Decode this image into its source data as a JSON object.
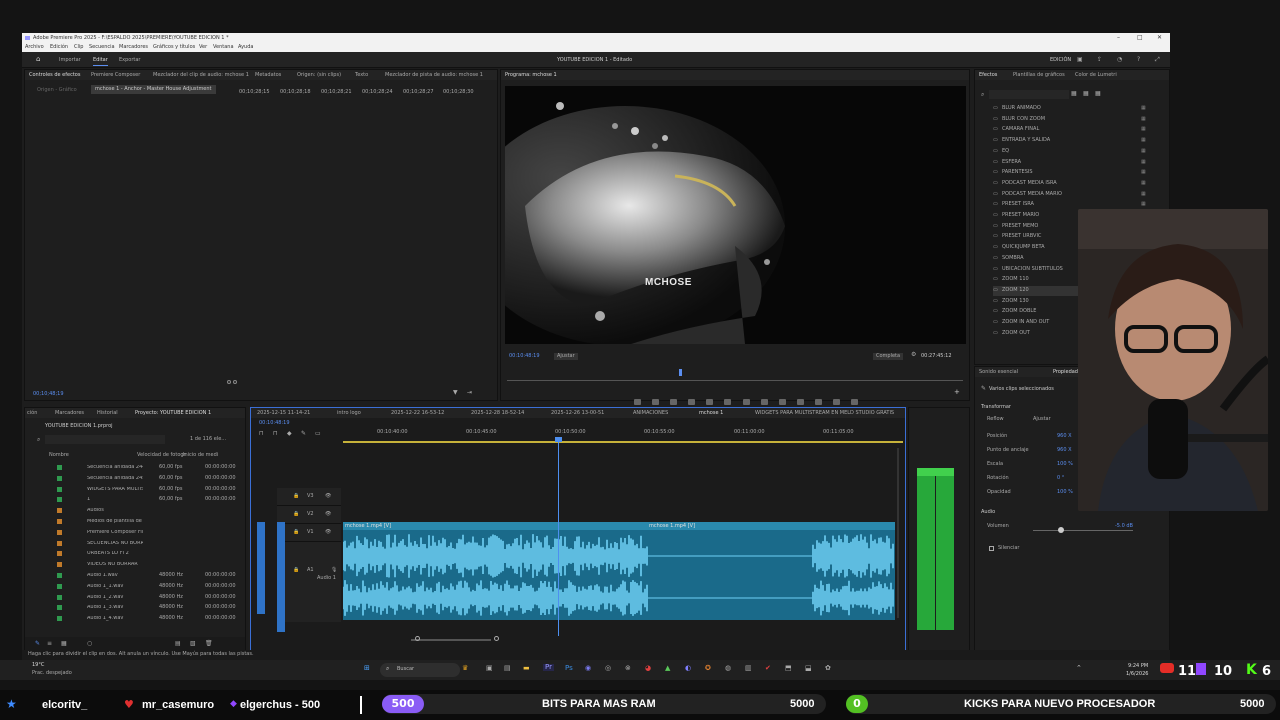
{
  "window": {
    "title": "Adobe Premiere Pro 2025 - F:\\ESPALDO 2025\\PREMIERE\\YOUTUBE EDICION 1 *"
  },
  "menu": [
    "Archivo",
    "Edición",
    "Clip",
    "Secuencia",
    "Marcadores",
    "Gráficos y títulos",
    "Ver",
    "Ventana",
    "Ayuda"
  ],
  "workspace": {
    "tabs": [
      "Importar",
      "Editar",
      "Exportar"
    ],
    "center_title": "YOUTUBE EDICION 1 - Editado",
    "right_label": "EDICIÓN"
  },
  "source_panel": {
    "tabs": [
      "Controles de efectos",
      "Premiere Composer",
      "Mezclador del clip de audio: mchose 1",
      "Metadatos",
      "Origen: (sin clips)",
      "Texto",
      "Mezclador de pista de audio: mchose 1"
    ],
    "sub_left": "Origen - Gráfico",
    "sub_selected": "mchose 1 - Anchor - Master House Adjustment",
    "ruler": [
      "00;10;28;15",
      "00;10;28;18",
      "00;10;28;21",
      "00;10;28;24",
      "00;10;28;27",
      "00;10;28;30"
    ],
    "timecode": "00;10;48;19"
  },
  "program": {
    "title": "Programa: mchose 1",
    "brand": "MCHOSE",
    "timecode_left": "00:10:48:19",
    "fit": "Ajustar",
    "quality": "Completa",
    "timecode_right": "00:27:45:12"
  },
  "effects": {
    "tabs": [
      "Efectos",
      "Plantillas de gráficos",
      "Color de Lumetri"
    ],
    "items": [
      "BLUR ANIMADO",
      "BLUR CON ZOOM",
      "CAMARA FINAL",
      "ENTRADA Y SALIDA",
      "EQ",
      "ESFERA",
      "PARENTESIS",
      "PODCAST MEDIA ISRA",
      "PODCAST MEDIA MARIO",
      "PRESET ISRA",
      "PRESET MARIO",
      "PRESET MEMO",
      "PRESET URBVIC",
      "QUICKJUMP BETA",
      "SOMBRA",
      "UBICACION SUBTITULOS",
      "ZOOM 110",
      "ZOOM 120",
      "ZOOM 130",
      "ZOOM DOBLE",
      "ZOOM IN AND OUT",
      "ZOOM OUT"
    ]
  },
  "properties": {
    "tabs": [
      "Sonido esencial",
      "Propiedades"
    ],
    "header": "Varios clips seleccionados",
    "transform": "Transformar",
    "reencuadre": "Reflow",
    "ajustar": "Ajustar",
    "rows": [
      {
        "label": "Posición",
        "value": "960 X"
      },
      {
        "label": "Punto de anclaje",
        "value": "960 X"
      },
      {
        "label": "Escala",
        "value": "100 %"
      },
      {
        "label": "Rotación",
        "value": "0 °"
      },
      {
        "label": "Opacidad",
        "value": "100 %"
      }
    ],
    "audio": "Audio",
    "volume_label": "Volumen",
    "volume_value": "-5.0 dB",
    "silence": "Silenciar"
  },
  "project": {
    "tabs": [
      "ción",
      "Marcadores",
      "Historial",
      "Proyecto: YOUTUBE EDICION 1"
    ],
    "file": "YOUTUBE EDICION 1.prproj",
    "count": "1 de 116 ele...",
    "columns": [
      "Nombre",
      "Velocidad de fotogr",
      "Inicio de medi"
    ],
    "items": [
      {
        "name": "Secuencia anidada 244",
        "fps": "60,00 fps",
        "start": "00:00:00:00",
        "color": "#2f9a4f"
      },
      {
        "name": "Secuencia anidada 245",
        "fps": "60,00 fps",
        "start": "00:00:00:00",
        "color": "#2f9a4f"
      },
      {
        "name": "WIDGETS PARA MULTISTRE",
        "fps": "60,00 fps",
        "start": "00:00:00:00",
        "color": "#2f9a4f"
      },
      {
        "name": "1",
        "fps": "60,00 fps",
        "start": "00:00:00:00",
        "color": "#2f9a4f"
      },
      {
        "name": "Audios",
        "fps": "",
        "start": "",
        "color": "#c07a2a"
      },
      {
        "name": "Medios de plantilla de gráfic",
        "fps": "",
        "start": "",
        "color": "#c07a2a"
      },
      {
        "name": "Premiere Composer Files",
        "fps": "",
        "start": "",
        "color": "#c07a2a"
      },
      {
        "name": "SECUENCIAS NO BORRAR",
        "fps": "",
        "start": "",
        "color": "#c07a2a"
      },
      {
        "name": "URBEATS LO FI 2",
        "fps": "",
        "start": "",
        "color": "#c07a2a"
      },
      {
        "name": "VIDEOS NO BORRAR",
        "fps": "",
        "start": "",
        "color": "#c07a2a"
      },
      {
        "name": "Audio 1.wav",
        "fps": "48000 Hz",
        "start": "00:00:00:00",
        "color": "#2f9a4f"
      },
      {
        "name": "Audio 1_1.wav",
        "fps": "48000 Hz",
        "start": "00:00:00:00",
        "color": "#2f9a4f"
      },
      {
        "name": "Audio 1_2.wav",
        "fps": "48000 Hz",
        "start": "00:00:00:00",
        "color": "#2f9a4f"
      },
      {
        "name": "Audio 1_3.wav",
        "fps": "48000 Hz",
        "start": "00:00:00:00",
        "color": "#2f9a4f"
      },
      {
        "name": "Audio 1_4.wav",
        "fps": "48000 Hz",
        "start": "00:00:00:00",
        "color": "#2f9a4f"
      }
    ]
  },
  "timeline": {
    "tabs": [
      "2025-12-15 11-14-21",
      "intro logo",
      "2025-12-22 16-53-12",
      "2025-12-28 18-52-14",
      "2025-12-26 13-00-51",
      "ANIMACIONES",
      "mchose 1",
      "WIDGETS PARA MULTISTREAM EN MELD STUDIO GRATIS"
    ],
    "timecode": "00:10:48:19",
    "ruler": [
      "00:10:40:00",
      "00:10:45:00",
      "00:10:50:00",
      "00:10:55:00",
      "00:11:00:00",
      "00:11:05:00"
    ],
    "tracks": [
      "V3",
      "V2",
      "V1",
      "A1"
    ],
    "clip1": "mchose 1.mp4 [V]",
    "clip2": "mchose 1.mp4 [V]",
    "audio_label": "Audio 1"
  },
  "status": "Haga clic para dividir el clip en dos. Alt anula un vínculo. Use Mayús para todas las pistas.",
  "taskbar": {
    "weather_temp": "19°C",
    "weather_desc": "Prac. despejado",
    "search": "Buscar",
    "time": "9:24 PM",
    "date": "1/6/2026"
  },
  "stream": {
    "yt_count": "11",
    "twitch_count": "10",
    "kick_count": "6",
    "ticker_users": [
      "elcoritv_",
      "mr_casemuro",
      "elgerchus - 500"
    ],
    "goal1": {
      "badge": "500",
      "label": "BITS PARA MAS RAM",
      "target": "5000",
      "color": "#8a5cf5"
    },
    "goal2": {
      "badge": "0",
      "label": "KICKS PARA NUEVO PROCESADOR",
      "target": "5000",
      "color": "#53c023"
    }
  }
}
